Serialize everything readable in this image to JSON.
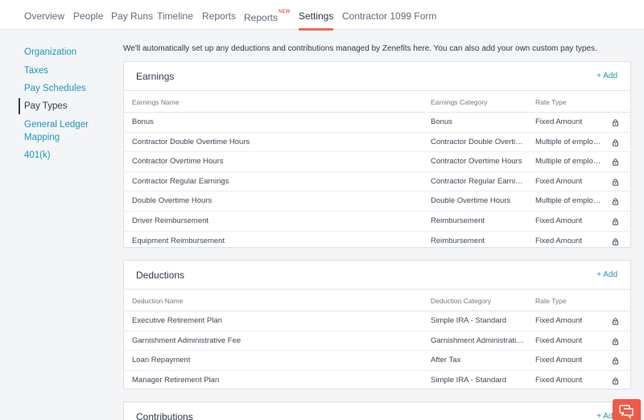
{
  "topnav": {
    "tabs": [
      {
        "label": "Overview"
      },
      {
        "label": "People"
      },
      {
        "label": "Pay Runs"
      },
      {
        "label": "Timeline"
      },
      {
        "label": "Reports"
      },
      {
        "label": "Reports",
        "badge": "NEW"
      },
      {
        "label": "Settings",
        "active": true
      },
      {
        "label": "Contractor 1099 Form"
      }
    ]
  },
  "sidebar": {
    "items": [
      {
        "label": "Organization"
      },
      {
        "label": "Taxes"
      },
      {
        "label": "Pay Schedules"
      },
      {
        "label": "Pay Types",
        "active": true
      },
      {
        "label": "General Ledger"
      },
      {
        "label": "Mapping"
      },
      {
        "label": "401(k)"
      }
    ]
  },
  "intro": "We'll automatically set up any deductions and contributions managed by Zenefits here. You can also add your own custom pay types.",
  "earnings": {
    "title": "Earnings",
    "add_label": "+ Add",
    "columns": [
      "Earnings Name",
      "Earnings Category",
      "Rate Type"
    ],
    "rows": [
      [
        "Bonus",
        "Bonus",
        "Fixed Amount"
      ],
      [
        "Contractor Double Overtime Hours",
        "Contractor Double Overtime Hours",
        "Multiple of employee rate"
      ],
      [
        "Contractor Overtime Hours",
        "Contractor Overtime Hours",
        "Multiple of employee rate"
      ],
      [
        "Contractor Regular Earnings",
        "Contractor Regular Earnings",
        "Fixed Amount"
      ],
      [
        "Double Overtime Hours",
        "Double Overtime Hours",
        "Multiple of employee rate"
      ],
      [
        "Driver Reimbursement",
        "Reimbursement",
        "Fixed Amount"
      ],
      [
        "Equipment Reimbursement",
        "Reimbursement",
        "Fixed Amount"
      ]
    ]
  },
  "deductions": {
    "title": "Deductions",
    "add_label": "+ Add",
    "columns": [
      "Deduction Name",
      "Deduction Category",
      "Rate Type"
    ],
    "rows": [
      [
        "Executive Retirement Plan",
        "Simple IRA - Standard",
        "Fixed Amount"
      ],
      [
        "Garnishment Administrative Fee",
        "Garnishment Administrative Fee",
        "Fixed Amount"
      ],
      [
        "Loan Repayment",
        "After Tax",
        "Fixed Amount"
      ],
      [
        "Manager Retirement Plan",
        "Simple IRA - Standard",
        "Fixed Amount"
      ]
    ]
  },
  "contributions": {
    "title": "Contributions",
    "add_label": "+ Add"
  },
  "icons": {
    "lock": "lock-icon",
    "chat": "chat-icon"
  },
  "colors": {
    "accent": "#f06a5a",
    "link": "#1e98b7",
    "chat": "#ee5a45"
  }
}
